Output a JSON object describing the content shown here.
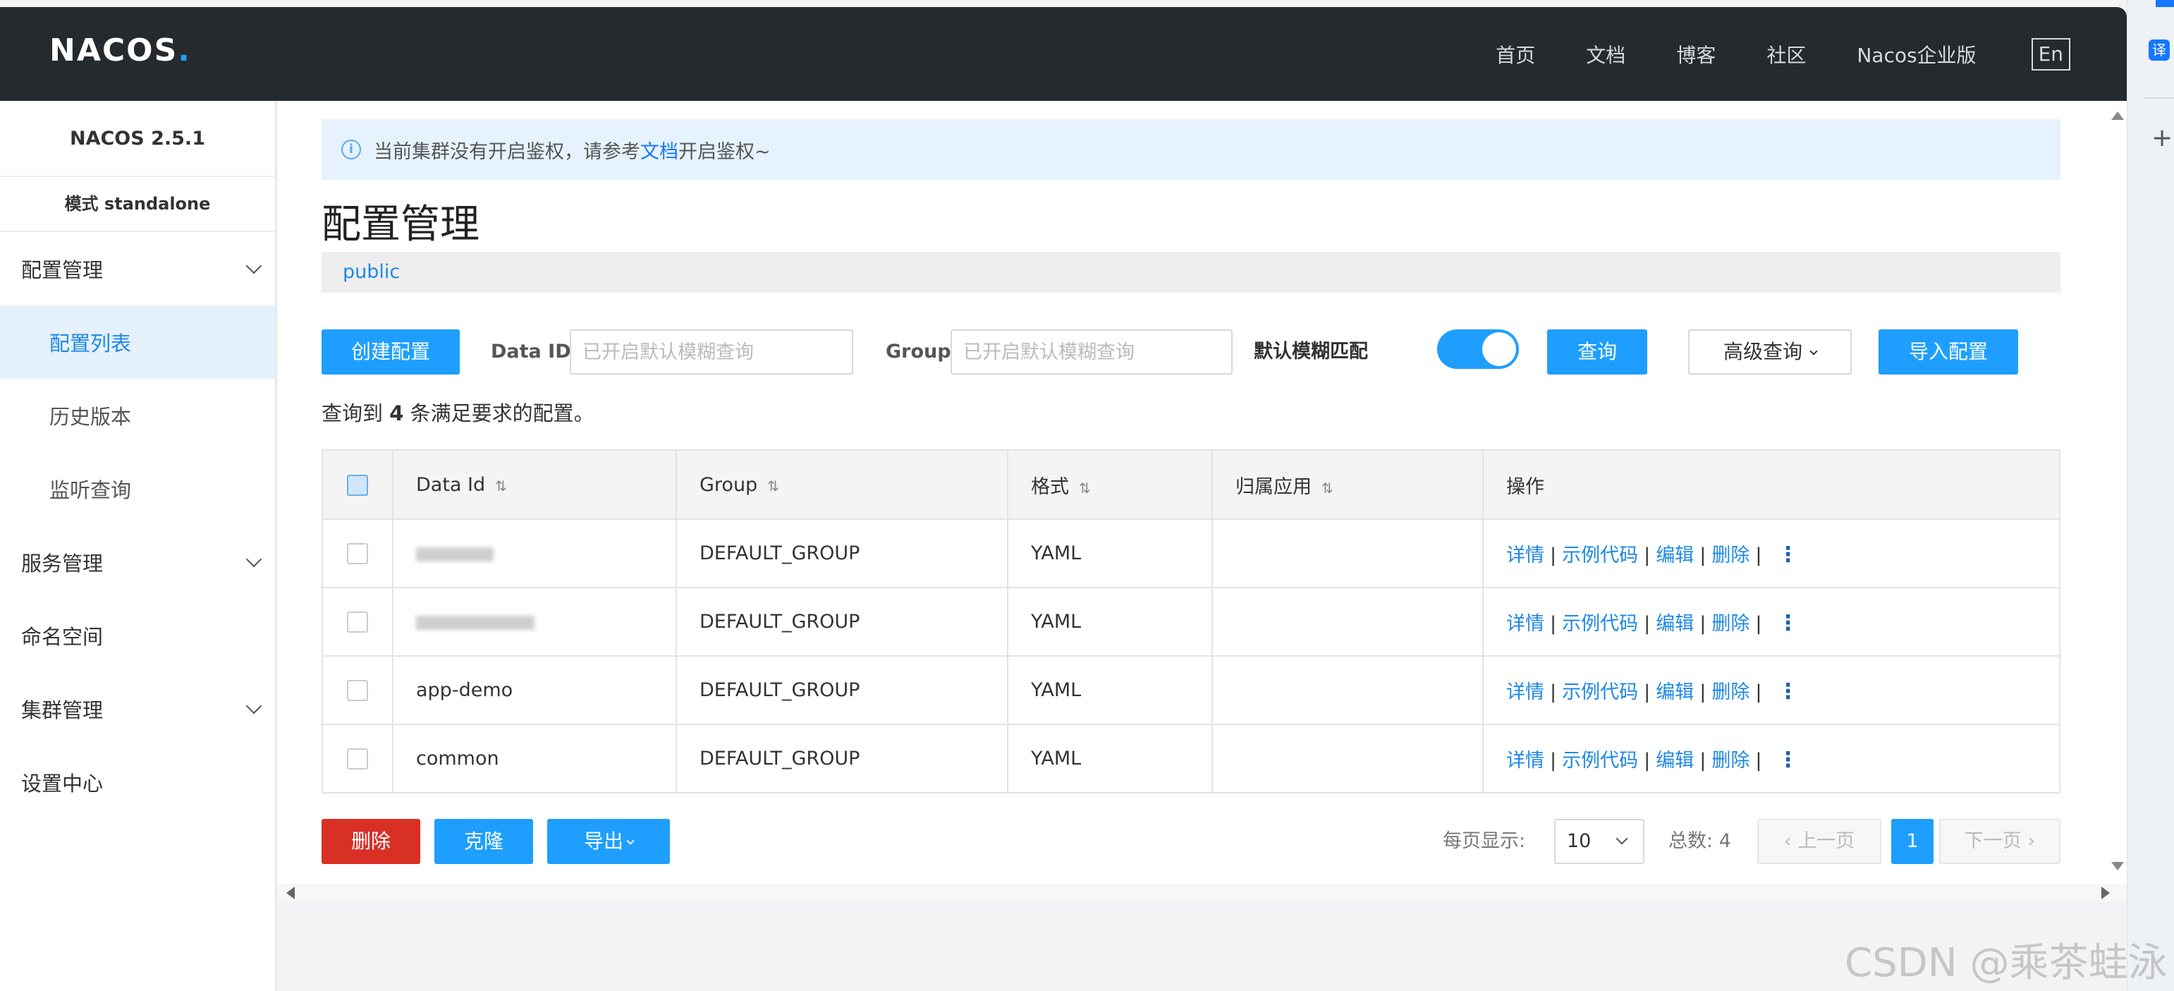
{
  "header": {
    "logo_text": "NAC",
    "logo_oo": "OS",
    "logo_dot": ".",
    "nav": [
      "首页",
      "文档",
      "博客",
      "社区",
      "Nacos企业版"
    ],
    "lang": "En"
  },
  "browser": {
    "translate_label": "译"
  },
  "sidebar": {
    "version": "NACOS 2.5.1",
    "mode": "模式 standalone",
    "items": [
      {
        "label": "配置管理"
      },
      {
        "label": "配置列表"
      },
      {
        "label": "历史版本"
      },
      {
        "label": "监听查询"
      },
      {
        "label": "服务管理"
      },
      {
        "label": "命名空间"
      },
      {
        "label": "集群管理"
      },
      {
        "label": "设置中心"
      }
    ]
  },
  "notice": {
    "prefix": "当前集群没有开启鉴权，请参考",
    "link": "文档",
    "suffix": "开启鉴权~"
  },
  "page": {
    "title": "配置管理",
    "namespace": "public"
  },
  "toolbar": {
    "create": "创建配置",
    "data_id_label": "Data ID",
    "data_id_placeholder": "已开启默认模糊查询",
    "group_label": "Group",
    "group_placeholder": "已开启默认模糊查询",
    "fuzzy_label": "默认模糊匹配",
    "fuzzy_on": true,
    "query": "查询",
    "advanced": "高级查询",
    "import": "导入配置"
  },
  "result": {
    "prefix": "查询到",
    "count": "4",
    "suffix": "条满足要求的配置。"
  },
  "table": {
    "headers": [
      "Data Id",
      "Group",
      "格式",
      "归属应用",
      "操作"
    ],
    "rows": [
      {
        "data_id": "",
        "group": "DEFAULT_GROUP",
        "format": "YAML",
        "app": ""
      },
      {
        "data_id": "",
        "group": "DEFAULT_GROUP",
        "format": "YAML",
        "app": ""
      },
      {
        "data_id": "app-demo",
        "group": "DEFAULT_GROUP",
        "format": "YAML",
        "app": ""
      },
      {
        "data_id": "common",
        "group": "DEFAULT_GROUP",
        "format": "YAML",
        "app": ""
      }
    ],
    "ops": {
      "detail": "详情",
      "sample": "示例代码",
      "edit": "编辑",
      "delete": "删除",
      "sep": "|"
    }
  },
  "bottom": {
    "delete": "删除",
    "clone": "克隆",
    "export": "导出",
    "page_size_label": "每页显示:",
    "page_size": "10",
    "total_label": "总数:",
    "total": "4",
    "prev": "上一页",
    "current_page": "1",
    "next": "下一页"
  },
  "watermark": "CSDN @乘茶蛙泳",
  "colors": {
    "accent": "#1e9fff",
    "header_bg": "#252a2f",
    "danger": "#d93026"
  }
}
